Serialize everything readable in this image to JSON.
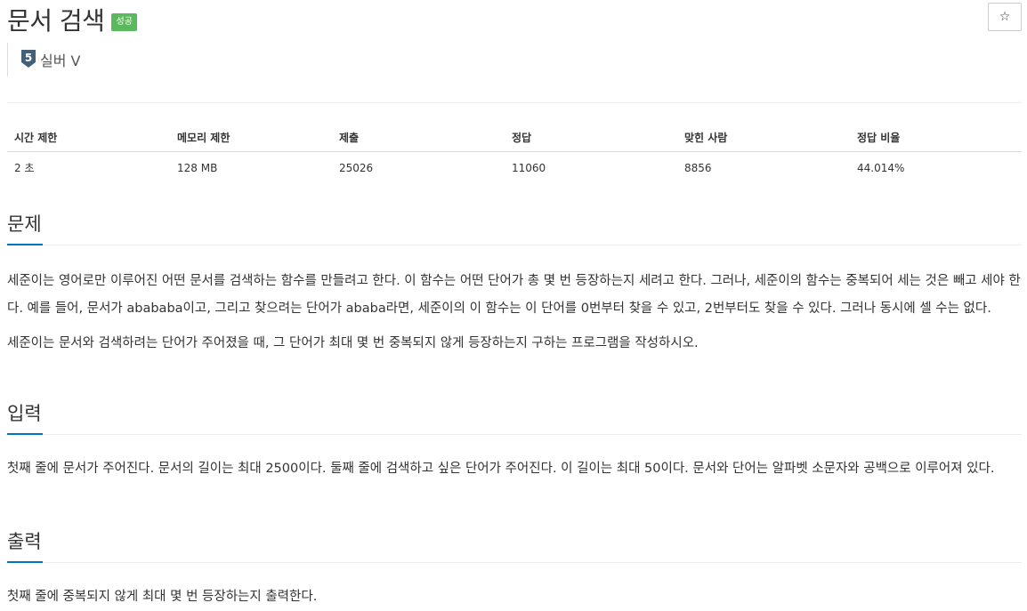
{
  "header": {
    "title": "문서 검색",
    "badge": "성공",
    "star_icon": "☆",
    "tier_number": "5",
    "tier_label": "실버 V",
    "tier_color": "#435f7a"
  },
  "info_table": {
    "headers": [
      "시간 제한",
      "메모리 제한",
      "제출",
      "정답",
      "맞힌 사람",
      "정답 비율"
    ],
    "values": [
      "2 초",
      "128 MB",
      "25026",
      "11060",
      "8856",
      "44.014%"
    ]
  },
  "sections": {
    "problem": {
      "title": "문제",
      "paragraphs": [
        "세준이는 영어로만 이루어진 어떤 문서를 검색하는 함수를 만들려고 한다. 이 함수는 어떤 단어가 총 몇 번 등장하는지 세려고 한다. 그러나, 세준이의 함수는 중복되어 세는 것은 빼고 세야 한다. 예를 들어, 문서가 abababa이고, 그리고 찾으려는 단어가 ababa라면, 세준이의 이 함수는 이 단어를 0번부터 찾을 수 있고, 2번부터도 찾을 수 있다. 그러나 동시에 셀 수는 없다.",
        "세준이는 문서와 검색하려는 단어가 주어졌을 때, 그 단어가 최대 몇 번 중복되지 않게 등장하는지 구하는 프로그램을 작성하시오."
      ]
    },
    "input": {
      "title": "입력",
      "text": "첫째 줄에 문서가 주어진다. 문서의 길이는 최대 2500이다. 둘째 줄에 검색하고 싶은 단어가 주어진다. 이 길이는 최대 50이다. 문서와 단어는 알파벳 소문자와 공백으로 이루어져 있다."
    },
    "output": {
      "title": "출력",
      "text": "첫째 줄에 중복되지 않게 최대 몇 번 등장하는지 출력한다."
    }
  },
  "colors": {
    "accent": "#0076c0",
    "success_badge": "#5cb85c"
  }
}
